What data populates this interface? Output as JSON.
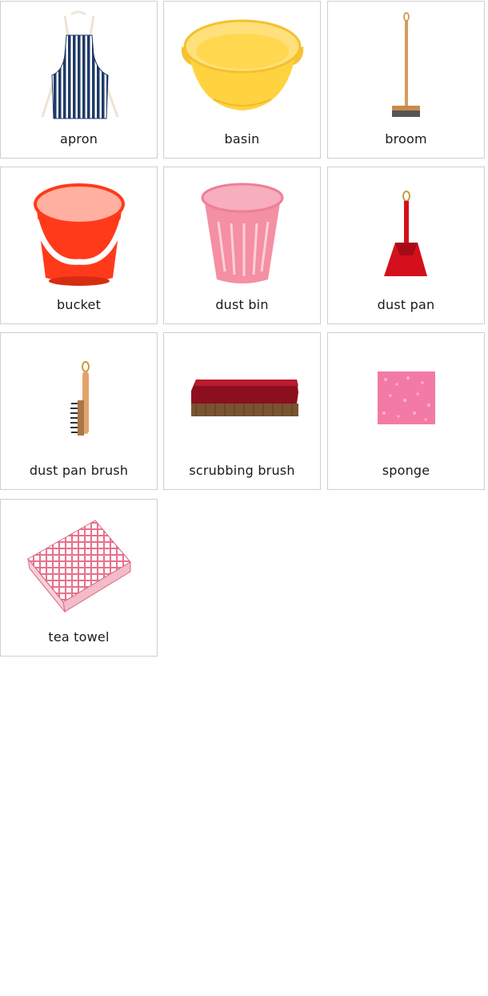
{
  "cards": [
    {
      "label": "apron",
      "icon": "apron-icon"
    },
    {
      "label": "basin",
      "icon": "basin-icon"
    },
    {
      "label": "broom",
      "icon": "broom-icon"
    },
    {
      "label": "bucket",
      "icon": "bucket-icon"
    },
    {
      "label": "dust bin",
      "icon": "dust-bin-icon"
    },
    {
      "label": "dust pan",
      "icon": "dust-pan-icon"
    },
    {
      "label": "dust pan brush",
      "icon": "dust-pan-brush-icon"
    },
    {
      "label": "scrubbing brush",
      "icon": "scrubbing-brush-icon"
    },
    {
      "label": "sponge",
      "icon": "sponge-icon"
    },
    {
      "label": "tea towel",
      "icon": "tea-towel-icon"
    }
  ],
  "colors": {
    "apron": "#1f3a66",
    "basin": "#ffd23f",
    "broom_handle": "#d79a5e",
    "bucket": "#ff3a1a",
    "dust_bin": "#f58fa3",
    "dust_pan": "#d4101c",
    "scrubbing_brush": "#8c0f1f",
    "sponge": "#f47aa6",
    "tea_towel": "#e8708a"
  }
}
